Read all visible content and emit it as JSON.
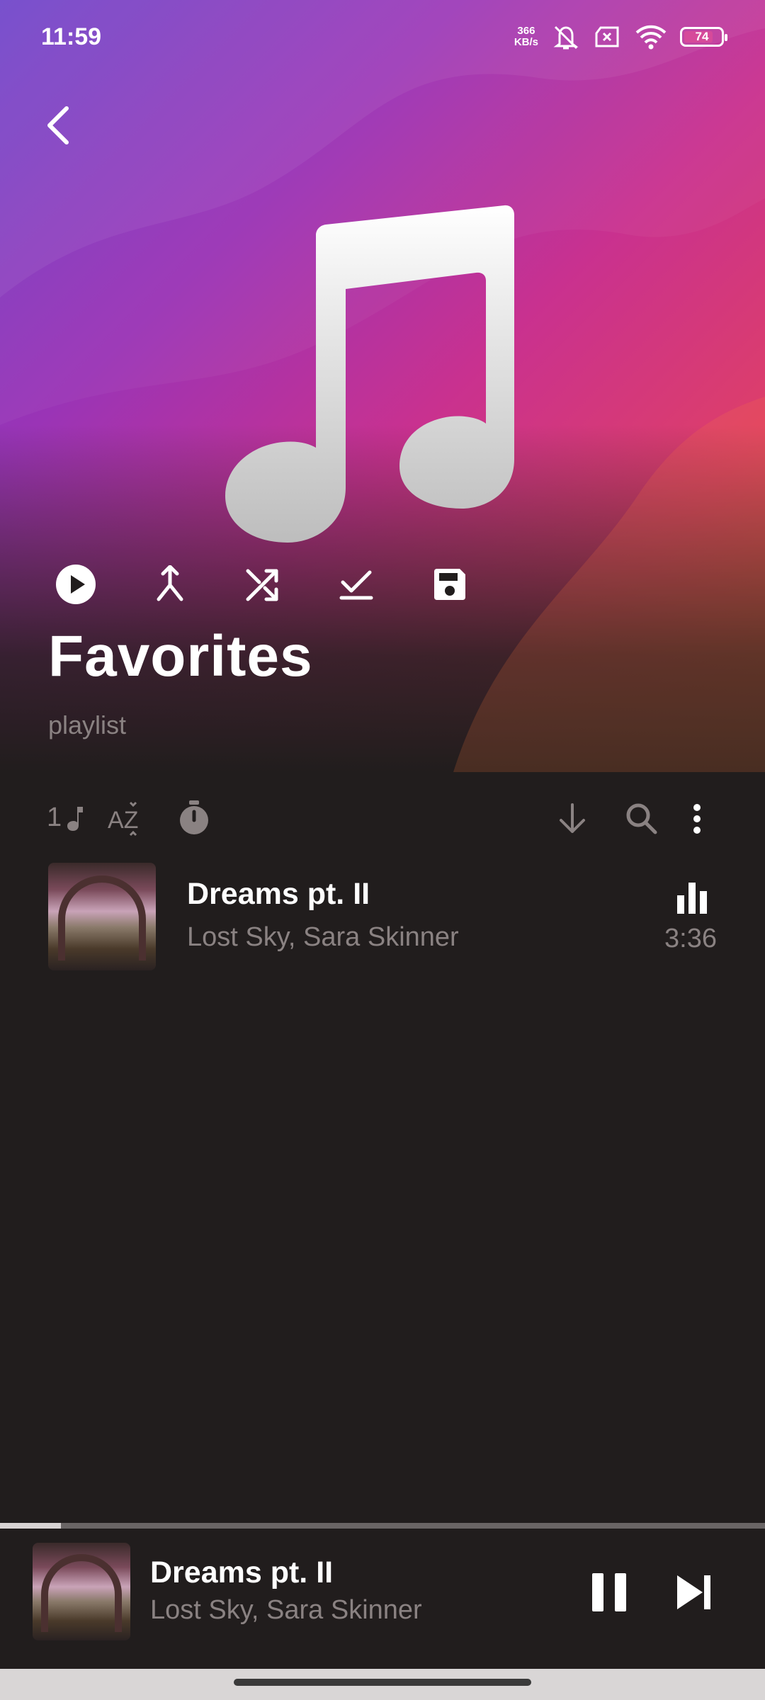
{
  "status_bar": {
    "time": "11:59",
    "net_speed_value": "366",
    "net_speed_unit": "KB/s",
    "battery": "74"
  },
  "header": {
    "title": "Favorites",
    "subtitle": "playlist",
    "actions": [
      "play-icon",
      "merge-icon",
      "shuffle-icon",
      "check-icon",
      "save-icon"
    ]
  },
  "toolbar": {
    "song_count": "1",
    "sort_label": "AZ",
    "icons": [
      "music-note-icon",
      "sort-az-icon",
      "timer-icon",
      "download-icon",
      "search-icon",
      "more-vert-icon"
    ]
  },
  "songs": [
    {
      "title": "Dreams pt. II",
      "artist": "Lost Sky, Sara Skinner",
      "duration": "3:36",
      "playing": true
    }
  ],
  "now_playing": {
    "title": "Dreams pt. II",
    "artist": "Lost Sky, Sara Skinner",
    "progress": 0.08
  },
  "colors": {
    "accent_gradient_start": "#6b3fc8",
    "accent_gradient_end": "#d95a3c",
    "background": "#211d1d",
    "muted_text": "#8a8282"
  }
}
